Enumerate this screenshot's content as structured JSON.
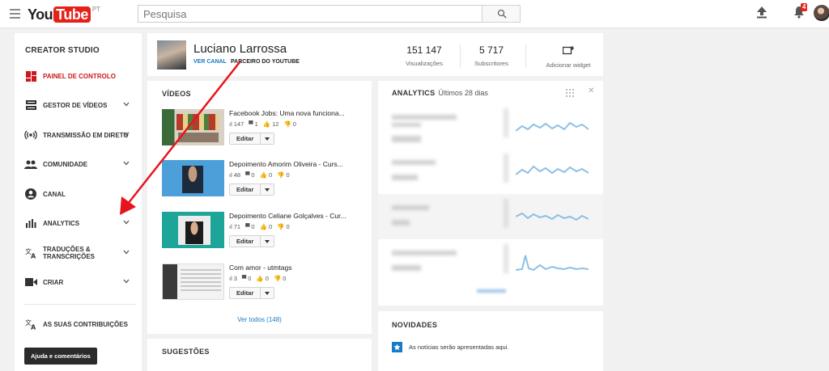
{
  "topbar": {
    "logo_you": "You",
    "logo_tube": "Tube",
    "logo_region": "PT",
    "search_placeholder": "Pesquisa",
    "notifications_count": "4"
  },
  "sidebar": {
    "title": "CREATOR STUDIO",
    "items": [
      {
        "label": "PAINEL DE CONTROLO",
        "icon": "dashboard-icon",
        "active": true
      },
      {
        "label": "GESTOR DE VÍDEOS",
        "icon": "video-manager-icon"
      },
      {
        "label": "TRANSMISSÃO EM DIRETO",
        "icon": "live-icon"
      },
      {
        "label": "COMUNIDADE",
        "icon": "people-icon"
      },
      {
        "label": "CANAL",
        "icon": "account-icon"
      },
      {
        "label": "ANALYTICS",
        "icon": "analytics-icon"
      },
      {
        "label": "TRADUÇÕES & TRANSCRIÇÕES",
        "label_line1": "TRADUÇÕES &",
        "label_line2": "TRANSCRIÇÕES",
        "icon": "translate-icon"
      },
      {
        "label": "CRIAR",
        "icon": "camera-icon"
      },
      {
        "label": "AS SUAS CONTRIBUIÇÕES",
        "icon": "translate-icon"
      }
    ],
    "help_label": "Ajuda e comentários"
  },
  "channel": {
    "name": "Luciano Larrossa",
    "view_channel": "VER CANAL",
    "partner": "PARCEIRO DO YOUTUBE",
    "views_value": "151 147",
    "views_label": "Visualizações",
    "subs_value": "5 717",
    "subs_label": "Subscritores",
    "add_widget_label": "Adicionar widget"
  },
  "videos": {
    "title": "VÍDEOS",
    "edit_label": "Editar",
    "see_all": "Ver todos (148)",
    "items": [
      {
        "title": "Facebook Jobs: Uma nova funciona...",
        "views": "147",
        "comments": "1",
        "likes": "12",
        "dislikes": "0"
      },
      {
        "title": "Depoimento Amorim Oliveira - Curs...",
        "views": "48",
        "comments": "0",
        "likes": "0",
        "dislikes": "0"
      },
      {
        "title": "Depoimento Celiane Golçalves - Cur...",
        "views": "71",
        "comments": "0",
        "likes": "0",
        "dislikes": "0"
      },
      {
        "title": "Com amor - utmtags",
        "views": "3",
        "comments": "0",
        "likes": "0",
        "dislikes": "0"
      }
    ]
  },
  "suggestions": {
    "title": "SUGESTÕES"
  },
  "analytics": {
    "title": "ANALYTICS",
    "period": "Últimos 28 dias"
  },
  "news": {
    "title": "NOVIDADES",
    "text": "As notícias serão apresentadas aqui."
  },
  "colors": {
    "brand_red": "#e62117",
    "link_blue": "#167ac6",
    "annotation_arrow": "#e8141c"
  }
}
